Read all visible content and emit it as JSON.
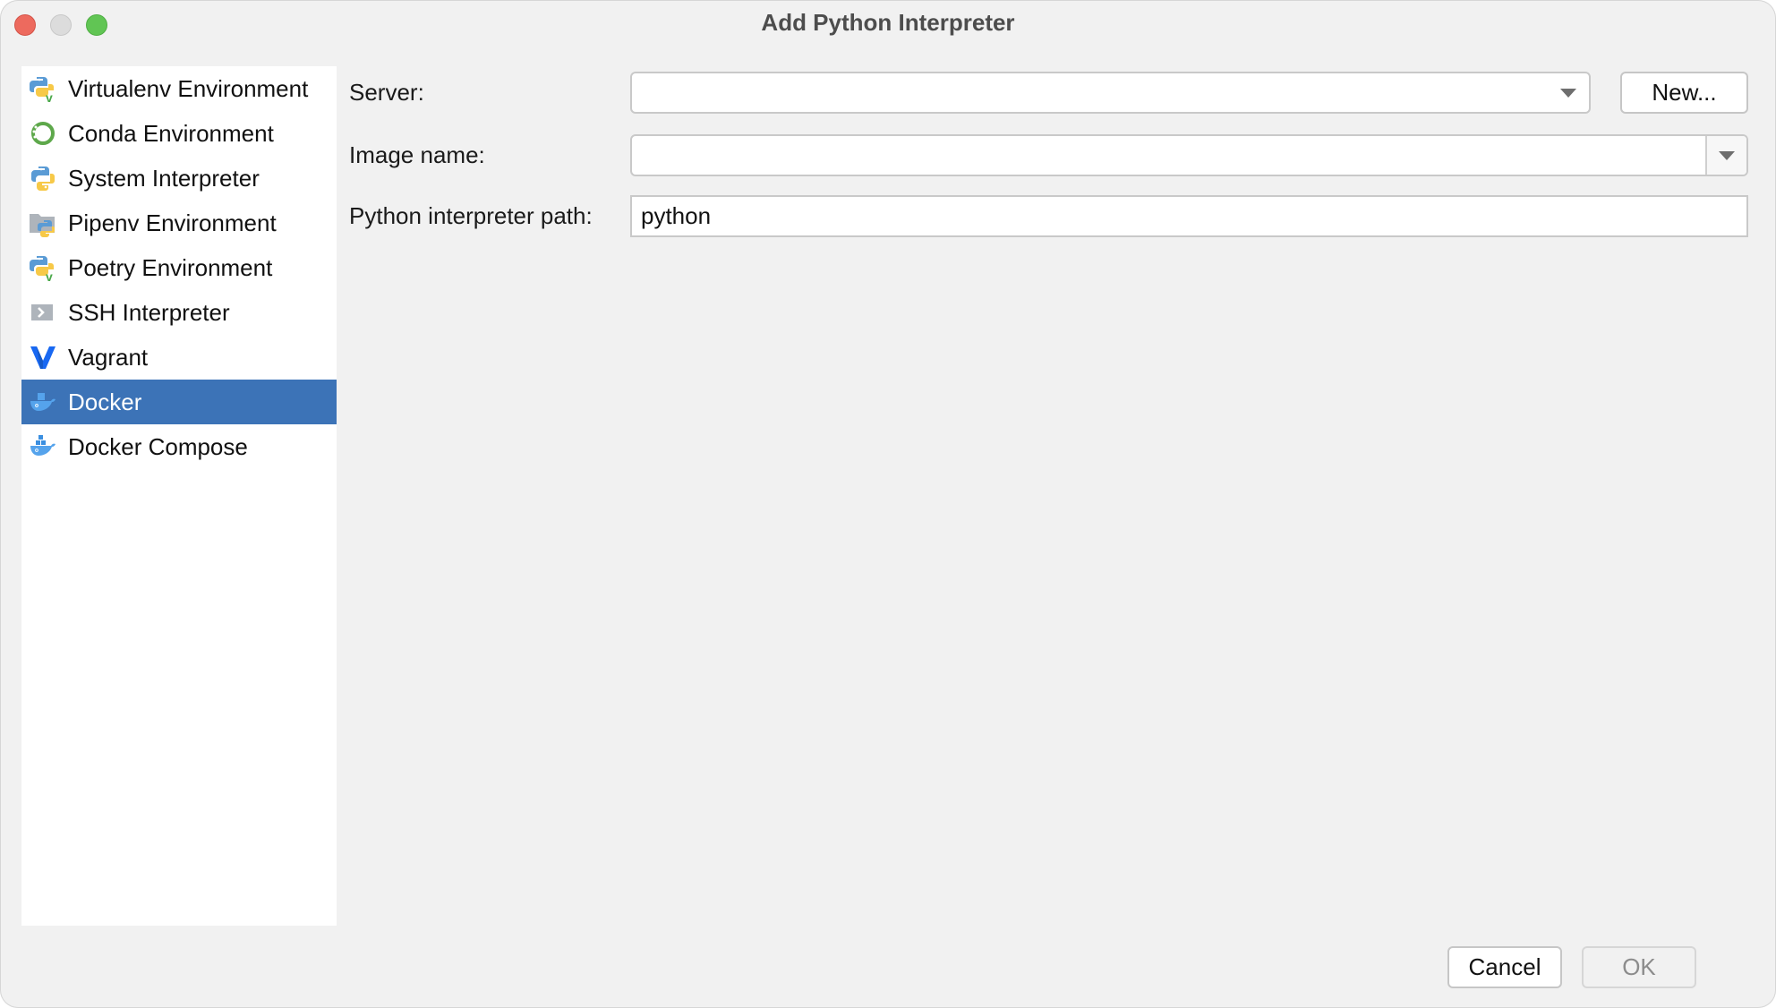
{
  "window": {
    "title": "Add Python Interpreter",
    "controls": [
      "close",
      "minimize",
      "maximize"
    ]
  },
  "sidebar": {
    "selected_index": 7,
    "items": [
      {
        "label": "Virtualenv Environment",
        "icon": "virtualenv-icon"
      },
      {
        "label": "Conda Environment",
        "icon": "conda-icon"
      },
      {
        "label": "System Interpreter",
        "icon": "python-icon"
      },
      {
        "label": "Pipenv Environment",
        "icon": "pipenv-icon"
      },
      {
        "label": "Poetry Environment",
        "icon": "poetry-icon"
      },
      {
        "label": "SSH Interpreter",
        "icon": "ssh-icon"
      },
      {
        "label": "Vagrant",
        "icon": "vagrant-icon"
      },
      {
        "label": "Docker",
        "icon": "docker-icon"
      },
      {
        "label": "Docker Compose",
        "icon": "docker-compose-icon"
      }
    ]
  },
  "form": {
    "server": {
      "label": "Server:",
      "value": ""
    },
    "new_button": "New...",
    "image_name": {
      "label": "Image name:",
      "value": ""
    },
    "python_path": {
      "label": "Python interpreter path:",
      "value": "python"
    }
  },
  "footer": {
    "cancel": "Cancel",
    "ok": "OK",
    "ok_enabled": false
  },
  "colors": {
    "selection": "#3c73b7",
    "background": "#f1f1f1"
  }
}
